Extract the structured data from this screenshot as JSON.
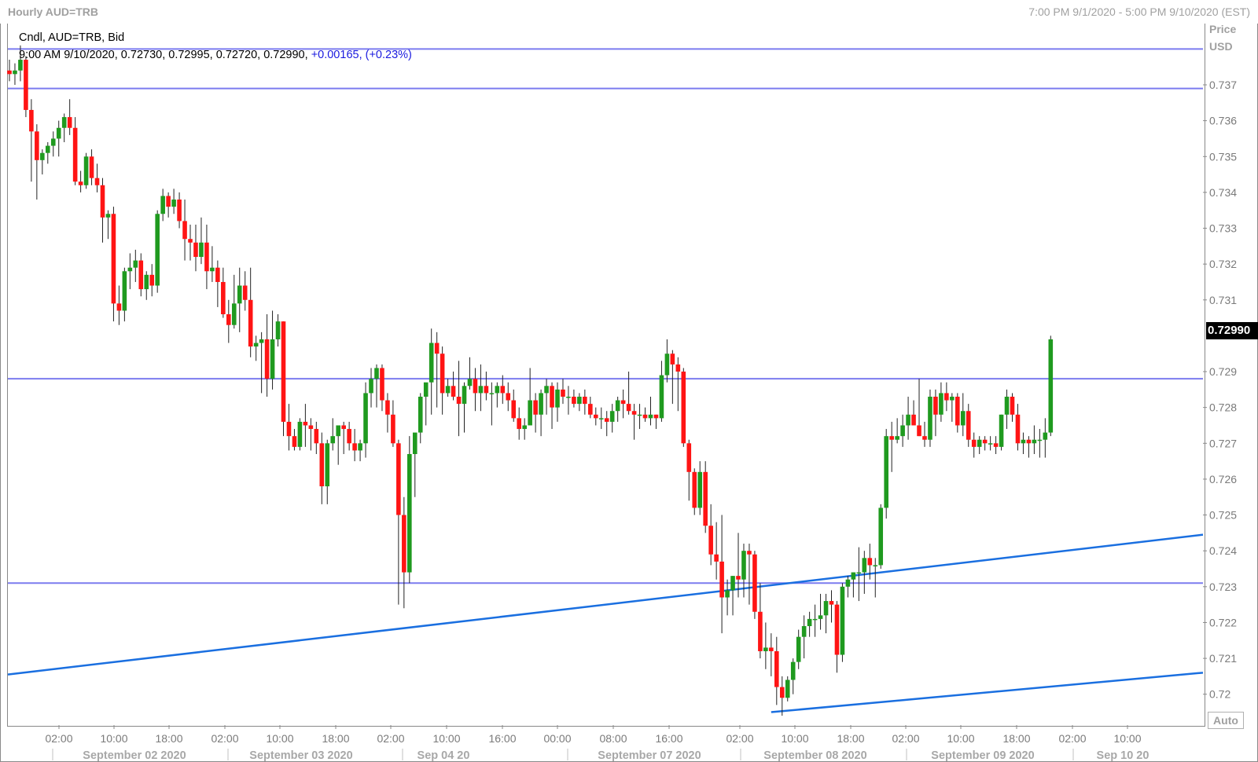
{
  "header": {
    "title": "Hourly AUD=TRB",
    "range": "7:00 PM 9/1/2020 - 5:00 PM 9/10/2020 (EST)"
  },
  "legend": {
    "line1": "Cndl, AUD=TRB, Bid",
    "ohlc": "9:00 AM 9/10/2020, 0.72730, 0.72995, 0.72720, 0.72990,",
    "change": "+0.00165, (+0.23%)"
  },
  "axis": {
    "price_label": "Price",
    "currency_label": "USD",
    "auto_button": "Auto",
    "last_price": "0.72990"
  },
  "colors": {
    "up": "#1f9a1f",
    "down": "#ff1414",
    "hline": "#7b7bef",
    "trendline": "#1a6fe0",
    "last_price_bg": "#000000"
  },
  "chart_data": {
    "type": "candlestick",
    "title": "Hourly AUD=TRB",
    "ylabel": "Price USD",
    "ylim": [
      0.7195,
      0.7383
    ],
    "y_ticks": [
      "0.737",
      "0.736",
      "0.735",
      "0.734",
      "0.733",
      "0.732",
      "0.731",
      "0.729",
      "0.728",
      "0.727",
      "0.726",
      "0.725",
      "0.724",
      "0.723",
      "0.722",
      "0.721",
      "0.72"
    ],
    "time_labels": [
      "02:00",
      "10:00",
      "18:00",
      "02:00",
      "10:00",
      "18:00",
      "02:00",
      "10:00",
      "16:00",
      "00:00",
      "08:00",
      "16:00",
      "02:00",
      "10:00",
      "18:00",
      "02:00",
      "10:00",
      "18:00",
      "02:00",
      "10:00"
    ],
    "date_labels": [
      "September 02 2020",
      "September 03 2020",
      "Sep 04 20",
      "September 07 2020",
      "September 08 2020",
      "September 09 2020",
      "Sep 10 20"
    ],
    "horizontal_lines": [
      0.738,
      0.7369,
      0.7288,
      0.7231
    ],
    "trendlines": [
      {
        "from": [
          "start",
          0.72055
        ],
        "to": [
          "end",
          0.72445
        ]
      },
      {
        "from": [
          "Sep 08 10:00",
          0.7195
        ],
        "to": [
          "end",
          0.7206
        ]
      }
    ],
    "last_close": 0.7299,
    "candles": [
      [
        0.7374,
        0.7377,
        0.7371,
        0.7373
      ],
      [
        0.7373,
        0.7376,
        0.737,
        0.7374
      ],
      [
        0.7374,
        0.7381,
        0.7371,
        0.7377
      ],
      [
        0.7377,
        0.7378,
        0.7361,
        0.7363
      ],
      [
        0.7363,
        0.7366,
        0.7343,
        0.7357
      ],
      [
        0.7357,
        0.7359,
        0.7338,
        0.7349
      ],
      [
        0.7349,
        0.7352,
        0.7345,
        0.7351
      ],
      [
        0.7351,
        0.7354,
        0.7348,
        0.7353
      ],
      [
        0.7353,
        0.7357,
        0.735,
        0.7355
      ],
      [
        0.7355,
        0.736,
        0.735,
        0.7358
      ],
      [
        0.7358,
        0.7362,
        0.7354,
        0.7361
      ],
      [
        0.7361,
        0.7366,
        0.7356,
        0.7358
      ],
      [
        0.7358,
        0.7361,
        0.7342,
        0.7343
      ],
      [
        0.7343,
        0.7346,
        0.734,
        0.7342
      ],
      [
        0.7342,
        0.7351,
        0.7341,
        0.735
      ],
      [
        0.735,
        0.7352,
        0.7342,
        0.7344
      ],
      [
        0.7344,
        0.7348,
        0.734,
        0.7342
      ],
      [
        0.7342,
        0.7344,
        0.7326,
        0.7333
      ],
      [
        0.7333,
        0.7335,
        0.7327,
        0.7334
      ],
      [
        0.7334,
        0.7336,
        0.7304,
        0.7309
      ],
      [
        0.7309,
        0.7314,
        0.7303,
        0.7307
      ],
      [
        0.7307,
        0.7319,
        0.7304,
        0.7318
      ],
      [
        0.7318,
        0.7323,
        0.7313,
        0.7319
      ],
      [
        0.7319,
        0.7324,
        0.7315,
        0.7321
      ],
      [
        0.7321,
        0.7323,
        0.7311,
        0.7313
      ],
      [
        0.7313,
        0.7318,
        0.731,
        0.7317
      ],
      [
        0.7317,
        0.732,
        0.7311,
        0.7314
      ],
      [
        0.7314,
        0.7335,
        0.7312,
        0.7334
      ],
      [
        0.7334,
        0.7341,
        0.7332,
        0.7339
      ],
      [
        0.7339,
        0.734,
        0.7333,
        0.7336
      ],
      [
        0.7336,
        0.7341,
        0.7334,
        0.7338
      ],
      [
        0.7338,
        0.734,
        0.733,
        0.7332
      ],
      [
        0.7332,
        0.7338,
        0.7321,
        0.7327
      ],
      [
        0.7327,
        0.7331,
        0.7321,
        0.7326
      ],
      [
        0.7326,
        0.7331,
        0.7318,
        0.7322
      ],
      [
        0.7322,
        0.7333,
        0.732,
        0.7326
      ],
      [
        0.7326,
        0.7331,
        0.7313,
        0.7318
      ],
      [
        0.7318,
        0.7325,
        0.7315,
        0.7319
      ],
      [
        0.7319,
        0.7321,
        0.7308,
        0.7315
      ],
      [
        0.7315,
        0.7319,
        0.7305,
        0.7306
      ],
      [
        0.7306,
        0.731,
        0.7298,
        0.7303
      ],
      [
        0.7303,
        0.7317,
        0.7302,
        0.7309
      ],
      [
        0.7309,
        0.7319,
        0.7301,
        0.7314
      ],
      [
        0.7314,
        0.7318,
        0.7307,
        0.731
      ],
      [
        0.731,
        0.7319,
        0.7294,
        0.7297
      ],
      [
        0.7297,
        0.73,
        0.7293,
        0.7298
      ],
      [
        0.7298,
        0.7301,
        0.7284,
        0.7299
      ],
      [
        0.7299,
        0.7306,
        0.7283,
        0.7288
      ],
      [
        0.7288,
        0.7307,
        0.7285,
        0.7299
      ],
      [
        0.7299,
        0.7306,
        0.7297,
        0.7304
      ],
      [
        0.7304,
        0.7304,
        0.7272,
        0.7276
      ],
      [
        0.7276,
        0.7281,
        0.7268,
        0.7272
      ],
      [
        0.7272,
        0.7274,
        0.7268,
        0.7269
      ],
      [
        0.7269,
        0.7277,
        0.7268,
        0.7276
      ],
      [
        0.7276,
        0.7281,
        0.7269,
        0.7275
      ],
      [
        0.7275,
        0.7277,
        0.7268,
        0.7274
      ],
      [
        0.7274,
        0.7276,
        0.7267,
        0.727
      ],
      [
        0.727,
        0.7273,
        0.7253,
        0.7258
      ],
      [
        0.7258,
        0.7271,
        0.7253,
        0.727
      ],
      [
        0.727,
        0.7277,
        0.7268,
        0.7272
      ],
      [
        0.7272,
        0.7273,
        0.7264,
        0.7275
      ],
      [
        0.7275,
        0.7276,
        0.7267,
        0.7274
      ],
      [
        0.7274,
        0.7276,
        0.7268,
        0.727
      ],
      [
        0.727,
        0.7274,
        0.7265,
        0.7268
      ],
      [
        0.7268,
        0.7271,
        0.7265,
        0.727
      ],
      [
        0.727,
        0.7287,
        0.7266,
        0.7284
      ],
      [
        0.7284,
        0.7291,
        0.728,
        0.7288
      ],
      [
        0.7288,
        0.7292,
        0.728,
        0.7291
      ],
      [
        0.7291,
        0.7292,
        0.7279,
        0.7282
      ],
      [
        0.7282,
        0.7284,
        0.7273,
        0.7278
      ],
      [
        0.7278,
        0.7282,
        0.7269,
        0.727
      ],
      [
        0.727,
        0.7271,
        0.7225,
        0.725
      ],
      [
        0.725,
        0.7255,
        0.7224,
        0.7234
      ],
      [
        0.7234,
        0.7272,
        0.7231,
        0.7267
      ],
      [
        0.7267,
        0.727,
        0.7255,
        0.7273
      ],
      [
        0.7273,
        0.7284,
        0.727,
        0.7283
      ],
      [
        0.7283,
        0.7285,
        0.7275,
        0.7287
      ],
      [
        0.7287,
        0.7302,
        0.7278,
        0.7298
      ],
      [
        0.7298,
        0.7301,
        0.728,
        0.7295
      ],
      [
        0.7295,
        0.7297,
        0.7278,
        0.7284
      ],
      [
        0.7284,
        0.7288,
        0.7283,
        0.7286
      ],
      [
        0.7286,
        0.729,
        0.7282,
        0.7283
      ],
      [
        0.7283,
        0.7293,
        0.7272,
        0.7281
      ],
      [
        0.7281,
        0.7287,
        0.7273,
        0.7286
      ],
      [
        0.7286,
        0.7294,
        0.7285,
        0.7288
      ],
      [
        0.7288,
        0.7291,
        0.7279,
        0.7284
      ],
      [
        0.7284,
        0.7292,
        0.7279,
        0.7286
      ],
      [
        0.7286,
        0.729,
        0.7282,
        0.7284
      ],
      [
        0.7284,
        0.7287,
        0.7275,
        0.7284
      ],
      [
        0.7284,
        0.7287,
        0.728,
        0.7286
      ],
      [
        0.7286,
        0.7289,
        0.7281,
        0.7284
      ],
      [
        0.7284,
        0.7287,
        0.7279,
        0.7282
      ],
      [
        0.7282,
        0.7285,
        0.7276,
        0.7277
      ],
      [
        0.7277,
        0.728,
        0.7271,
        0.7274
      ],
      [
        0.7274,
        0.7277,
        0.7271,
        0.7275
      ],
      [
        0.7275,
        0.7291,
        0.7275,
        0.7282
      ],
      [
        0.7282,
        0.7284,
        0.7273,
        0.7278
      ],
      [
        0.7278,
        0.7285,
        0.7272,
        0.7284
      ],
      [
        0.7284,
        0.7288,
        0.7278,
        0.7286
      ],
      [
        0.7286,
        0.7287,
        0.7274,
        0.728
      ],
      [
        0.728,
        0.7287,
        0.7276,
        0.7285
      ],
      [
        0.7285,
        0.7288,
        0.7281,
        0.7283
      ],
      [
        0.7283,
        0.7286,
        0.7278,
        0.7283
      ],
      [
        0.7283,
        0.7285,
        0.728,
        0.7281
      ],
      [
        0.7281,
        0.7284,
        0.7279,
        0.7283
      ],
      [
        0.7283,
        0.7285,
        0.7278,
        0.7281
      ],
      [
        0.7281,
        0.7283,
        0.7277,
        0.7278
      ],
      [
        0.7278,
        0.728,
        0.7275,
        0.7277
      ],
      [
        0.7277,
        0.728,
        0.7274,
        0.7277
      ],
      [
        0.7277,
        0.7279,
        0.7272,
        0.7276
      ],
      [
        0.7276,
        0.7281,
        0.7273,
        0.7279
      ],
      [
        0.7279,
        0.7283,
        0.7276,
        0.7282
      ],
      [
        0.7282,
        0.7285,
        0.7277,
        0.7281
      ],
      [
        0.7281,
        0.729,
        0.7278,
        0.7279
      ],
      [
        0.7279,
        0.7281,
        0.7271,
        0.7278
      ],
      [
        0.7278,
        0.7281,
        0.7274,
        0.7278
      ],
      [
        0.7278,
        0.728,
        0.7276,
        0.7277
      ],
      [
        0.7277,
        0.7283,
        0.7275,
        0.7278
      ],
      [
        0.7278,
        0.7278,
        0.7274,
        0.7277
      ],
      [
        0.7277,
        0.7293,
        0.7276,
        0.7289
      ],
      [
        0.7289,
        0.7299,
        0.7287,
        0.7295
      ],
      [
        0.7295,
        0.7296,
        0.7281,
        0.7292
      ],
      [
        0.7292,
        0.7294,
        0.7279,
        0.729
      ],
      [
        0.729,
        0.7291,
        0.7269,
        0.727
      ],
      [
        0.727,
        0.7271,
        0.7254,
        0.7262
      ],
      [
        0.7262,
        0.7263,
        0.725,
        0.7252
      ],
      [
        0.7252,
        0.7265,
        0.725,
        0.7262
      ],
      [
        0.7262,
        0.7265,
        0.7245,
        0.7247
      ],
      [
        0.7247,
        0.7253,
        0.7236,
        0.7239
      ],
      [
        0.7239,
        0.7248,
        0.7232,
        0.7237
      ],
      [
        0.7237,
        0.725,
        0.7217,
        0.7227
      ],
      [
        0.7227,
        0.7232,
        0.7222,
        0.7229
      ],
      [
        0.7229,
        0.7233,
        0.7222,
        0.7233
      ],
      [
        0.7233,
        0.7245,
        0.7227,
        0.7232
      ],
      [
        0.7232,
        0.7242,
        0.7227,
        0.724
      ],
      [
        0.724,
        0.7242,
        0.7225,
        0.7239
      ],
      [
        0.7239,
        0.724,
        0.7221,
        0.7223
      ],
      [
        0.7223,
        0.7231,
        0.721,
        0.7212
      ],
      [
        0.7212,
        0.722,
        0.7207,
        0.7213
      ],
      [
        0.7213,
        0.7217,
        0.7205,
        0.7212
      ],
      [
        0.7212,
        0.7216,
        0.7197,
        0.7202
      ],
      [
        0.7202,
        0.7205,
        0.7194,
        0.7199
      ],
      [
        0.7199,
        0.7205,
        0.7198,
        0.7204
      ],
      [
        0.7204,
        0.721,
        0.72,
        0.7209
      ],
      [
        0.7209,
        0.7218,
        0.7207,
        0.7216
      ],
      [
        0.7216,
        0.7222,
        0.721,
        0.7219
      ],
      [
        0.7219,
        0.7223,
        0.7216,
        0.7221
      ],
      [
        0.7221,
        0.7225,
        0.7216,
        0.7221
      ],
      [
        0.7221,
        0.7228,
        0.7218,
        0.7222
      ],
      [
        0.7222,
        0.7228,
        0.7217,
        0.7226
      ],
      [
        0.7226,
        0.7229,
        0.722,
        0.7225
      ],
      [
        0.7225,
        0.7226,
        0.7206,
        0.7211
      ],
      [
        0.7211,
        0.7231,
        0.7209,
        0.723
      ],
      [
        0.723,
        0.7233,
        0.7227,
        0.7232
      ],
      [
        0.7232,
        0.7234,
        0.7227,
        0.7234
      ],
      [
        0.7234,
        0.7241,
        0.7226,
        0.7234
      ],
      [
        0.7234,
        0.724,
        0.7228,
        0.7238
      ],
      [
        0.7238,
        0.7242,
        0.7232,
        0.7236
      ],
      [
        0.7236,
        0.7238,
        0.7227,
        0.7236
      ],
      [
        0.7236,
        0.7253,
        0.7235,
        0.7252
      ],
      [
        0.7252,
        0.7274,
        0.7249,
        0.7272
      ],
      [
        0.7272,
        0.7276,
        0.7262,
        0.7271
      ],
      [
        0.7271,
        0.7277,
        0.727,
        0.7272
      ],
      [
        0.7272,
        0.7278,
        0.7269,
        0.7275
      ],
      [
        0.7275,
        0.7283,
        0.7271,
        0.7278
      ],
      [
        0.7278,
        0.7282,
        0.7276,
        0.7275
      ],
      [
        0.7275,
        0.7288,
        0.7272,
        0.7272
      ],
      [
        0.7272,
        0.7276,
        0.7269,
        0.7271
      ],
      [
        0.7271,
        0.7285,
        0.7269,
        0.7283
      ],
      [
        0.7283,
        0.7285,
        0.7272,
        0.7278
      ],
      [
        0.7278,
        0.7287,
        0.7276,
        0.7284
      ],
      [
        0.7284,
        0.7287,
        0.7279,
        0.7282
      ],
      [
        0.7282,
        0.7284,
        0.7276,
        0.7283
      ],
      [
        0.7283,
        0.7284,
        0.7273,
        0.7275
      ],
      [
        0.7275,
        0.7284,
        0.7272,
        0.7279
      ],
      [
        0.7279,
        0.7281,
        0.7269,
        0.7271
      ],
      [
        0.7271,
        0.7273,
        0.7266,
        0.7269
      ],
      [
        0.7269,
        0.7272,
        0.7267,
        0.7271
      ],
      [
        0.7271,
        0.7272,
        0.7268,
        0.727
      ],
      [
        0.727,
        0.7272,
        0.7268,
        0.727
      ],
      [
        0.727,
        0.7272,
        0.7267,
        0.7269
      ],
      [
        0.7269,
        0.7278,
        0.7268,
        0.7278
      ],
      [
        0.7278,
        0.7285,
        0.7274,
        0.7283
      ],
      [
        0.7283,
        0.7284,
        0.7276,
        0.7278
      ],
      [
        0.7278,
        0.7281,
        0.7268,
        0.727
      ],
      [
        0.727,
        0.7273,
        0.7267,
        0.7271
      ],
      [
        0.7271,
        0.7272,
        0.7266,
        0.727
      ],
      [
        0.727,
        0.7275,
        0.7267,
        0.7271
      ],
      [
        0.7271,
        0.7274,
        0.7266,
        0.7271
      ],
      [
        0.7271,
        0.7277,
        0.7266,
        0.7273
      ],
      [
        0.7273,
        0.73,
        0.7272,
        0.7299
      ]
    ]
  }
}
